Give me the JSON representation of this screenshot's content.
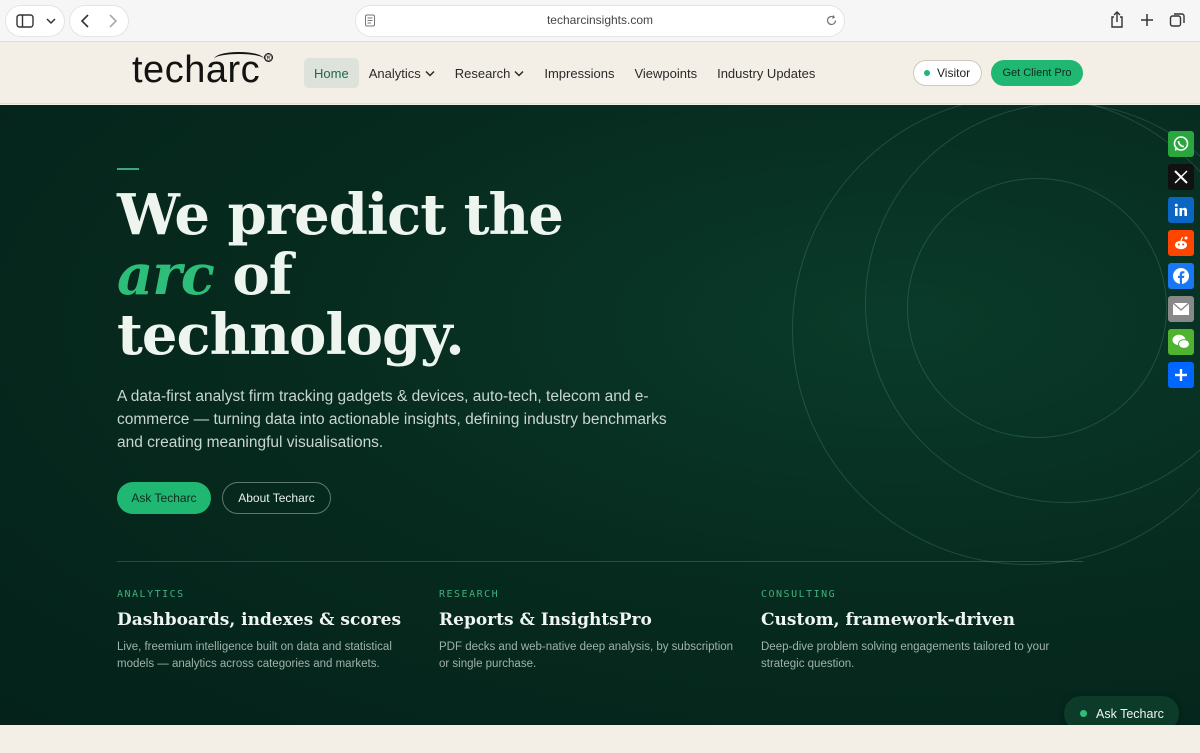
{
  "browser": {
    "url": "techarcinsights.com"
  },
  "header": {
    "logo": "techarc",
    "logo_mark": "®",
    "nav": [
      {
        "label": "Home",
        "active": true
      },
      {
        "label": "Analytics",
        "dropdown": true
      },
      {
        "label": "Research",
        "dropdown": true
      },
      {
        "label": "Impressions"
      },
      {
        "label": "Viewpoints"
      },
      {
        "label": "Industry Updates"
      }
    ],
    "visitor_label": "Visitor",
    "client_pro_label": "Get Client Pro"
  },
  "hero": {
    "title_line1": "We predict the",
    "title_accent": "arc",
    "title_line2_rest": " of",
    "title_line3": "technology.",
    "description": "A data-first analyst firm tracking gadgets & devices, auto-tech, telecom and e-commerce — turning data into actionable insights, defining industry benchmarks and creating meaningful visualisations.",
    "primary_button": "Ask Techarc",
    "secondary_button": "About Techarc"
  },
  "features": [
    {
      "label": "ANALYTICS",
      "title": "Dashboards, indexes & scores",
      "desc": "Live, freemium intelligence built on data and statistical models — analytics across categories and markets."
    },
    {
      "label": "RESEARCH",
      "title": "Reports & InsightsPro",
      "desc": "PDF decks and web-native deep analysis, by subscription or single purchase."
    },
    {
      "label": "CONSULTING",
      "title": "Custom, framework-driven",
      "desc": "Deep-dive problem solving engagements tailored to your strategic question."
    }
  ],
  "share_icons": [
    "whatsapp-icon",
    "x-icon",
    "linkedin-icon",
    "reddit-icon",
    "facebook-icon",
    "email-icon",
    "wechat-icon",
    "share-icon"
  ],
  "colors": {
    "accent": "#1fb772",
    "hero_bg": "#062a1e",
    "page_bg": "#f3efe6"
  },
  "floating": {
    "ask_label": "Ask Techarc"
  }
}
